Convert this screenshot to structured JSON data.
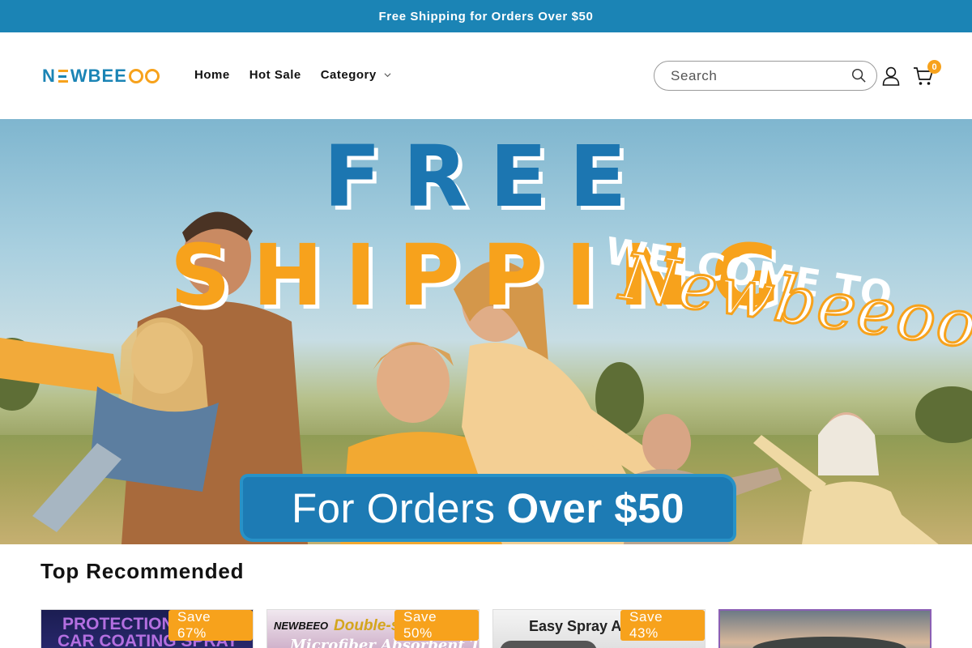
{
  "announcement": "Free Shipping for Orders Over $50",
  "brand": {
    "logo_text": "NEWBEEOO"
  },
  "nav": {
    "items": [
      {
        "label": "Home"
      },
      {
        "label": "Hot Sale"
      },
      {
        "label": "Category",
        "has_dropdown": true
      }
    ]
  },
  "search": {
    "placeholder": "Search"
  },
  "cart": {
    "count": "0"
  },
  "colors": {
    "brand_blue": "#1b84b5",
    "accent_orange": "#f7a21c"
  },
  "hero": {
    "title_word_1": "FREE",
    "title_word_2": "SHIPPING",
    "welcome": "WELCOME TO",
    "script_brand": "Newbeeoo",
    "banner_prefix": "For Orders",
    "banner_emphasis": "Over $50"
  },
  "section": {
    "title": "Top Recommended"
  },
  "products": [
    {
      "badge": "Save 67%",
      "image_text_1": "PROTECTION",
      "image_text_2": "CAR COATING SPRAY"
    },
    {
      "badge": "Save 50%",
      "image_text_1": "NEWBEEO",
      "image_text_2": "Double-si",
      "image_text_3": "Microfiber Absorbent Towel"
    },
    {
      "badge": "Save 43%",
      "image_text_1": "Easy Spray App"
    },
    {
      "badge": ""
    }
  ]
}
